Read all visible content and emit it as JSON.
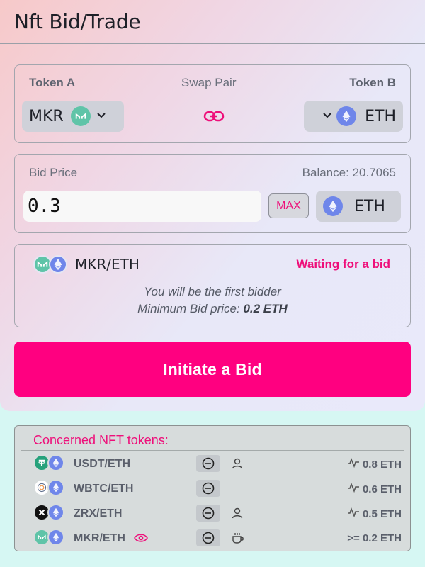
{
  "title": "Nft Bid/Trade",
  "swap": {
    "token_a_label": "Token A",
    "swap_pair_label": "Swap Pair",
    "token_b_label": "Token B",
    "token_a": "MKR",
    "token_b": "ETH"
  },
  "bid": {
    "label": "Bid Price",
    "balance": "Balance: 20.7065",
    "value": "0.3",
    "max_label": "MAX",
    "currency": "ETH"
  },
  "status": {
    "pair": "MKR/ETH",
    "state": "Waiting for a bid",
    "line1": "You will be the first bidder",
    "line2_prefix": "Minimum Bid price:",
    "line2_value": "0.2 ETH"
  },
  "cta_label": "Initiate a Bid",
  "nft": {
    "title": "Concerned NFT tokens:",
    "rows": [
      {
        "pair": "USDT/ETH",
        "price": "0.8 ETH"
      },
      {
        "pair": "WBTC/ETH",
        "price": "0.6 ETH"
      },
      {
        "pair": "ZRX/ETH",
        "price": "0.5 ETH"
      },
      {
        "pair": "MKR/ETH",
        "price": ">= 0.2 ETH"
      }
    ]
  },
  "colors": {
    "accent": "#ff0080",
    "accent_text": "#ee0f7a",
    "mkr": "#5fc4a8",
    "eth": "#6f86ea",
    "usdt": "#26a17b"
  }
}
